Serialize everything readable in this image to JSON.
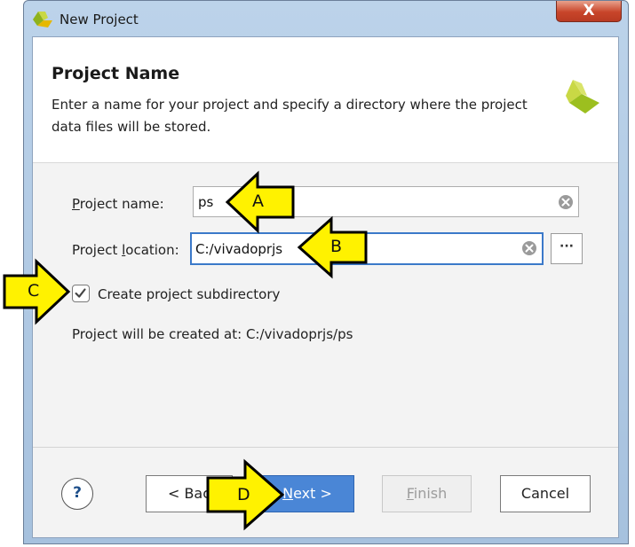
{
  "window": {
    "title": "New Project",
    "close_label": "X"
  },
  "header": {
    "title": "Project Name",
    "description": "Enter a name for your project and specify a directory where the project data files will be stored."
  },
  "form": {
    "name_label_underlined": "P",
    "name_label_rest": "roject name:",
    "name_value": "ps",
    "location_label_start": "Project ",
    "location_label_underlined": "l",
    "location_label_rest": "ocation:",
    "location_value": "C:/vivadoprjs",
    "browse_label": "···",
    "subdir_label": "Create project subdirectory",
    "subdir_checked": true,
    "created_at_text": "Project will be created at: C:/vivadoprjs/ps"
  },
  "buttons": {
    "help": "?",
    "back_visible": "< Bac",
    "next_underlined": "N",
    "next_rest": "ext >",
    "finish_underlined": "F",
    "finish_rest": "inish",
    "cancel": "Cancel"
  },
  "annotations": {
    "a": "A",
    "b": "B",
    "c": "C",
    "d": "D"
  },
  "colors": {
    "arrow_fill": "#fff200",
    "arrow_stroke": "#000000",
    "accent_blue": "#4a86d6",
    "xilinx_green": "#9cbf1f"
  }
}
